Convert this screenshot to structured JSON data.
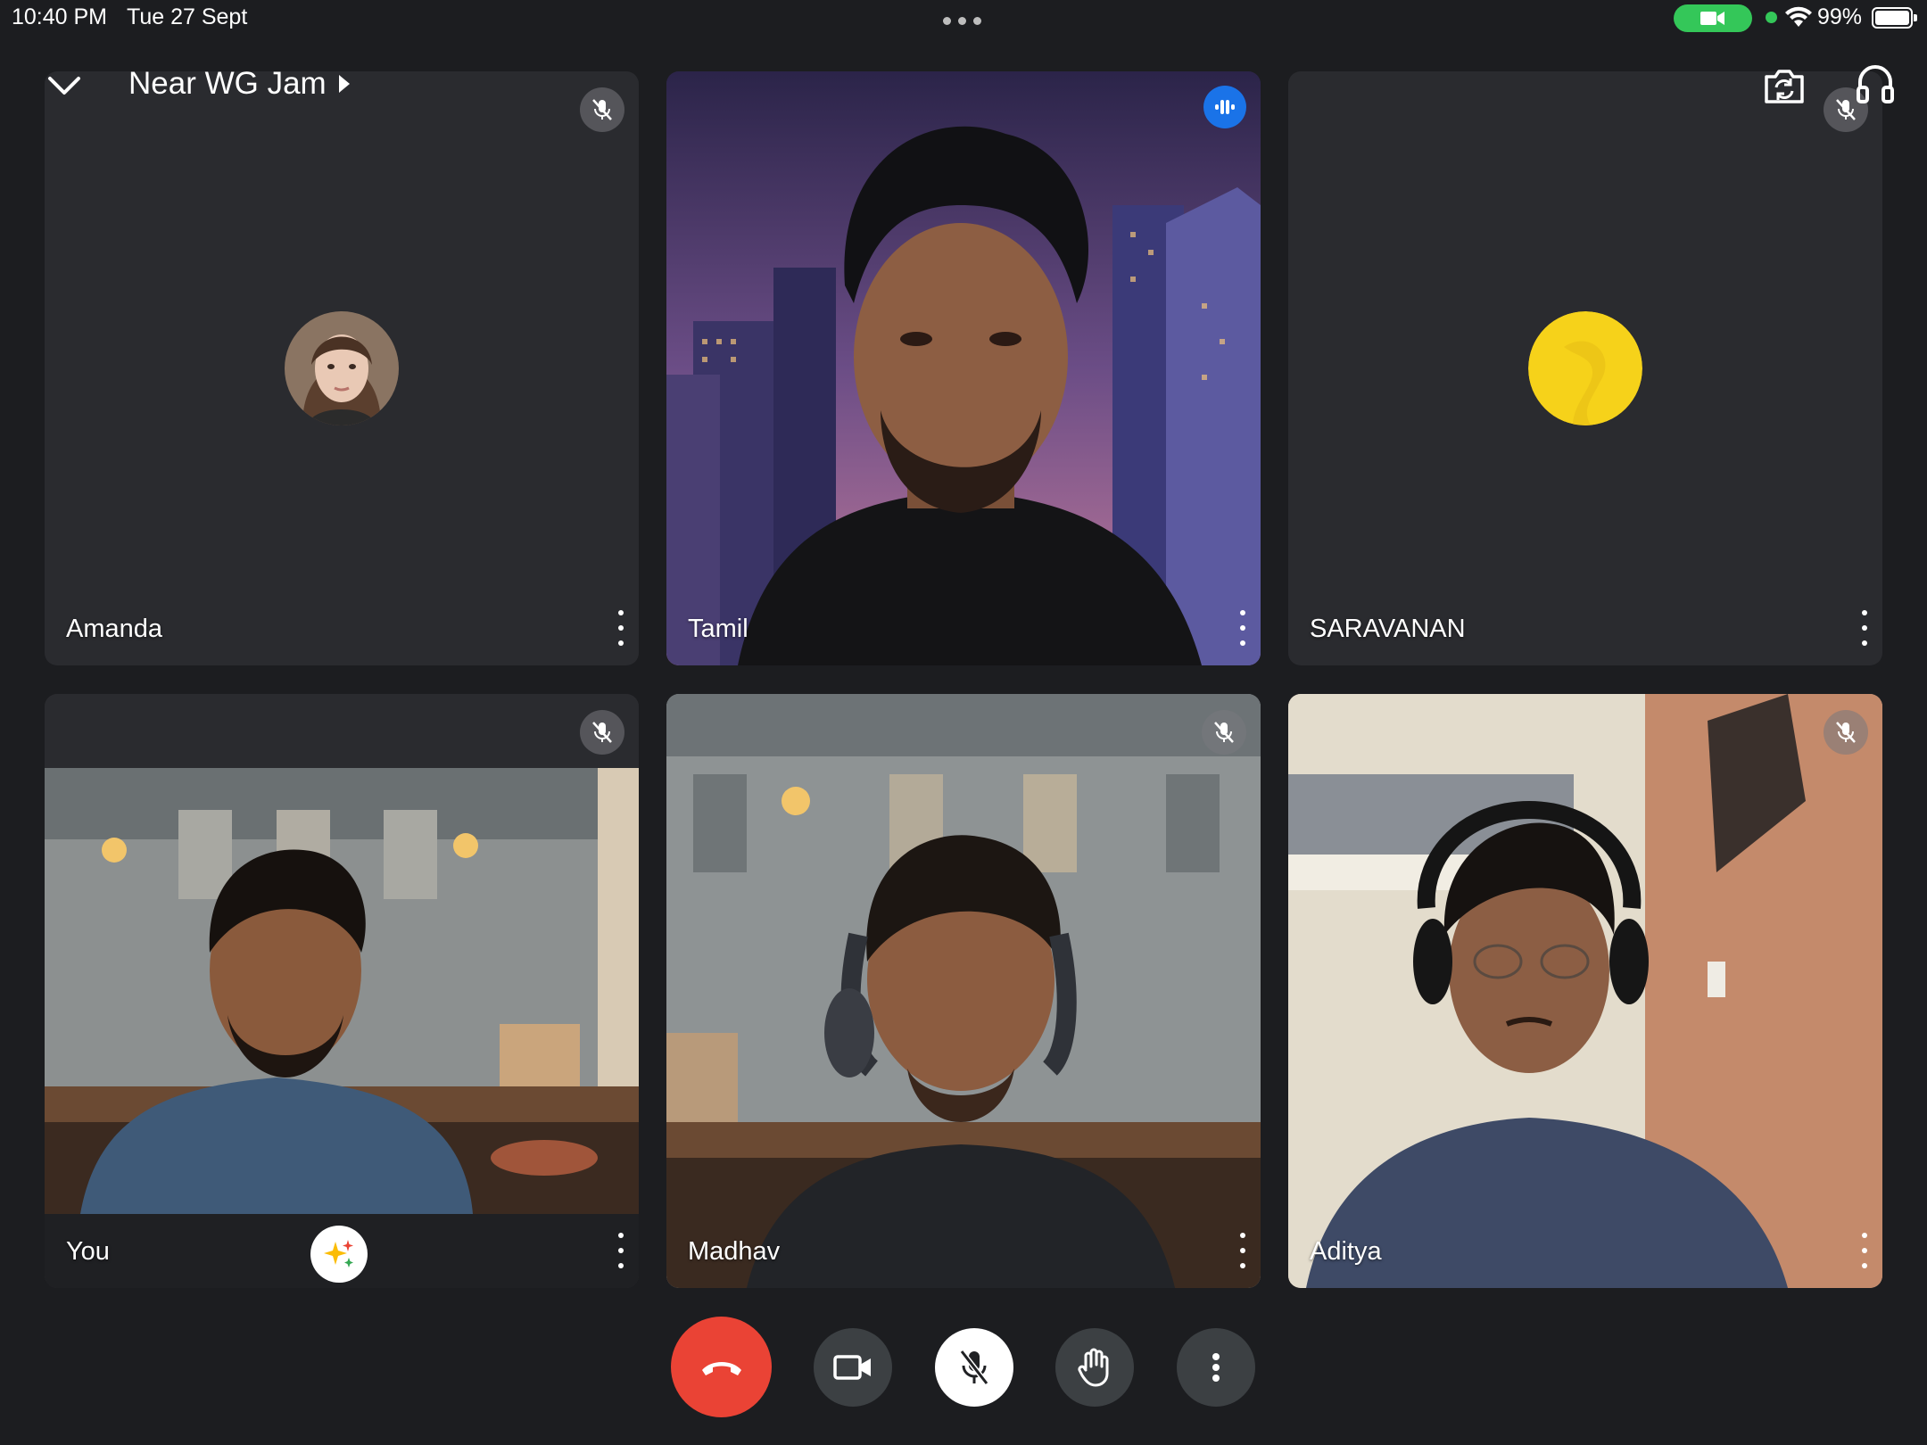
{
  "status_bar": {
    "time": "10:40 PM",
    "date": "Tue 27 Sept",
    "battery": "99%"
  },
  "header": {
    "meeting_title": "Near WG Jam"
  },
  "participants": [
    {
      "name": "Amanda",
      "muted": true,
      "video": false
    },
    {
      "name": "Tamil",
      "muted": false,
      "speaking": true,
      "video": true
    },
    {
      "name": "SARAVANAN",
      "muted": true,
      "video": false
    },
    {
      "name": "You",
      "muted": true,
      "video": true
    },
    {
      "name": "Madhav",
      "muted": true,
      "video": true
    },
    {
      "name": "Aditya",
      "muted": true,
      "video": true
    }
  ],
  "icons": {
    "collapse": "chevron-down-icon",
    "switch_camera": "switch-camera-icon",
    "audio_output": "headphones-icon",
    "end_call": "end-call-icon",
    "camera": "video-camera-icon",
    "mic": "mic-off-icon",
    "raise_hand": "raise-hand-icon",
    "more": "more-vertical-icon",
    "effects": "sparkle-icon"
  },
  "colors": {
    "background": "#1c1d20",
    "tile": "#2a2b2f",
    "end_call": "#ea4335",
    "control": "#3c4043",
    "speaking": "#1a73e8",
    "saravanan_avatar": "#f6d21a"
  }
}
